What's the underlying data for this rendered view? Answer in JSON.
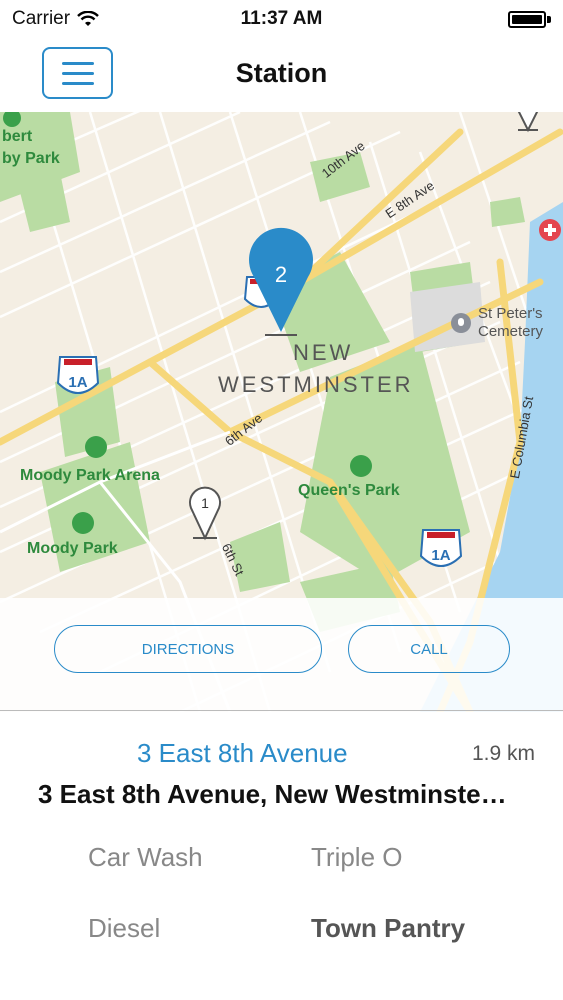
{
  "status_bar": {
    "carrier": "Carrier",
    "time": "11:37 AM"
  },
  "nav": {
    "title": "Station"
  },
  "map": {
    "place_labels": {
      "park_top_left": "bert\nby Park",
      "moody_park_arena": "Moody Park Arena",
      "moody_park": "Moody Park",
      "queens_park": "Queen's Park",
      "cemetery": "St Peter's\nCemetery",
      "city_line1": "NEW",
      "city_line2": "WESTMINSTER"
    },
    "street_labels": {
      "tenth_ave": "10th Ave",
      "e_eighth_ave": "E 8th Ave",
      "sixth_ave": "6th Ave",
      "sixth_st": "6th St",
      "e_columbia_st": "E Columbia St"
    },
    "pins": {
      "selected": "2",
      "other": "1"
    },
    "highway_shield": "1A",
    "colors": {
      "park": "#b9dca3",
      "water": "#a6d4f1",
      "road": "#f6d77a",
      "pin": "#2a8bc9"
    }
  },
  "actions": {
    "directions": "DIRECTIONS",
    "call": "CALL"
  },
  "station": {
    "name": "3 East 8th Avenue",
    "distance": "1.9 km",
    "address": "3 East 8th Avenue, New Westminste…",
    "amenities": [
      "Car Wash",
      "Triple O",
      "Diesel",
      "Town Pantry"
    ]
  }
}
